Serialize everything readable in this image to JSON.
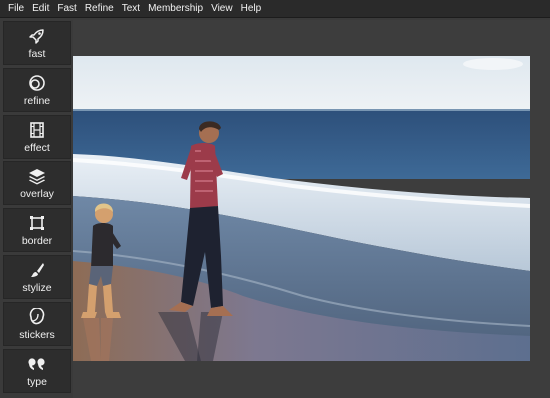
{
  "menu": [
    {
      "label": "File"
    },
    {
      "label": "Edit"
    },
    {
      "label": "Fast"
    },
    {
      "label": "Refine"
    },
    {
      "label": "Text"
    },
    {
      "label": "Membership"
    },
    {
      "label": "View"
    },
    {
      "label": "Help"
    }
  ],
  "tools": [
    {
      "label": "fast",
      "icon": "rocket-icon"
    },
    {
      "label": "refine",
      "icon": "refine-icon"
    },
    {
      "label": "effect",
      "icon": "film-icon"
    },
    {
      "label": "overlay",
      "icon": "layers-icon"
    },
    {
      "label": "border",
      "icon": "frame-icon"
    },
    {
      "label": "stylize",
      "icon": "brush-icon"
    },
    {
      "label": "stickers",
      "icon": "sticker-icon"
    },
    {
      "label": "type",
      "icon": "quote-icon"
    }
  ],
  "colors": {
    "accent": "#2d2d2d",
    "menubar": "#2a2a2a",
    "workspace": "#3d3d3d"
  }
}
